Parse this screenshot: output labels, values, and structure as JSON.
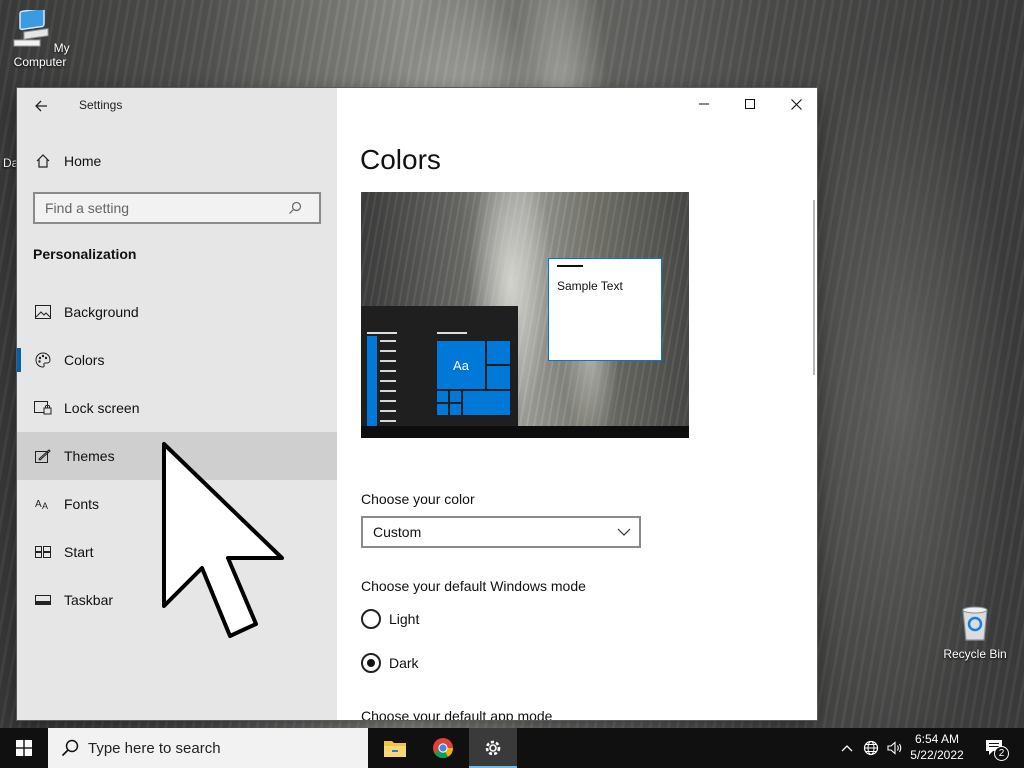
{
  "desktop": {
    "my_computer_label": "My Computer",
    "recycle_bin_label": "Recycle Bin",
    "partial_icon_label": "Da"
  },
  "window": {
    "title": "Settings",
    "controls": {
      "minimize": "minimize-icon",
      "maximize": "maximize-icon",
      "close": "close-icon"
    }
  },
  "sidebar": {
    "home_label": "Home",
    "search_placeholder": "Find a setting",
    "section_label": "Personalization",
    "items": [
      {
        "label": "Background",
        "icon": "picture-icon"
      },
      {
        "label": "Colors",
        "icon": "palette-icon"
      },
      {
        "label": "Lock screen",
        "icon": "lock-screen-icon"
      },
      {
        "label": "Themes",
        "icon": "themes-icon"
      },
      {
        "label": "Fonts",
        "icon": "fonts-icon"
      },
      {
        "label": "Start",
        "icon": "start-icon"
      },
      {
        "label": "Taskbar",
        "icon": "taskbar-icon"
      }
    ],
    "selected": "Colors",
    "hovered": "Themes"
  },
  "content": {
    "title": "Colors",
    "preview": {
      "sample_text": "Sample Text",
      "tile_text": "Aa"
    },
    "choose_color_label": "Choose your color",
    "choose_color_value": "Custom",
    "windows_mode_label": "Choose your default Windows mode",
    "windows_mode_options": [
      "Light",
      "Dark"
    ],
    "windows_mode_selected": "Dark",
    "app_mode_label": "Choose your default app mode"
  },
  "taskbar": {
    "search_placeholder": "Type here to search",
    "apps": [
      "file-explorer-icon",
      "chrome-icon",
      "settings-icon"
    ],
    "active_app": "settings-icon",
    "time": "6:54 AM",
    "date": "5/22/2022",
    "notification_count": "2"
  },
  "colors": {
    "accent": "#0078d7",
    "sidebar_bg": "#e6e6e6",
    "taskbar_bg": "#101010"
  }
}
